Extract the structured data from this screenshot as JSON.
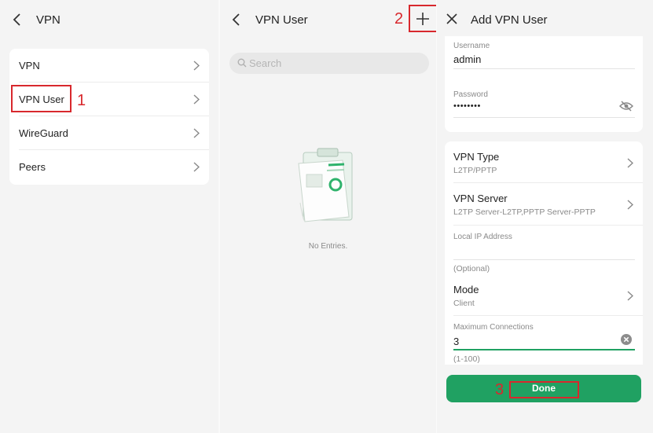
{
  "panel1": {
    "title": "VPN",
    "items": [
      {
        "label": "VPN"
      },
      {
        "label": "VPN User"
      },
      {
        "label": "WireGuard"
      },
      {
        "label": "Peers"
      }
    ],
    "step_marker": "1"
  },
  "panel2": {
    "title": "VPN User",
    "search_placeholder": "Search",
    "empty_text": "No Entries.",
    "step_marker": "2"
  },
  "panel3": {
    "title": "Add VPN User",
    "username_label": "Username",
    "username_value": "admin",
    "password_label": "Password",
    "password_value": "••••••••",
    "vpn_type_label": "VPN Type",
    "vpn_type_value": "L2TP/PPTP",
    "vpn_server_label": "VPN Server",
    "vpn_server_value": "L2TP Server-L2TP,PPTP Server-PPTP",
    "local_ip_label": "Local IP Address",
    "local_ip_hint": "(Optional)",
    "mode_label": "Mode",
    "mode_value": "Client",
    "max_conn_label": "Maximum Connections",
    "max_conn_value": "3",
    "max_conn_hint": "(1-100)",
    "done_label": "Done",
    "step_marker": "3"
  },
  "colors": {
    "accent": "#20a162",
    "annotation": "#d8282d",
    "background": "#f4f4f4"
  },
  "icons": [
    "back-icon",
    "chevron-right-icon",
    "search-icon",
    "plus-icon",
    "close-icon",
    "eye-off-icon",
    "clear-icon",
    "clipboard-illustration"
  ]
}
